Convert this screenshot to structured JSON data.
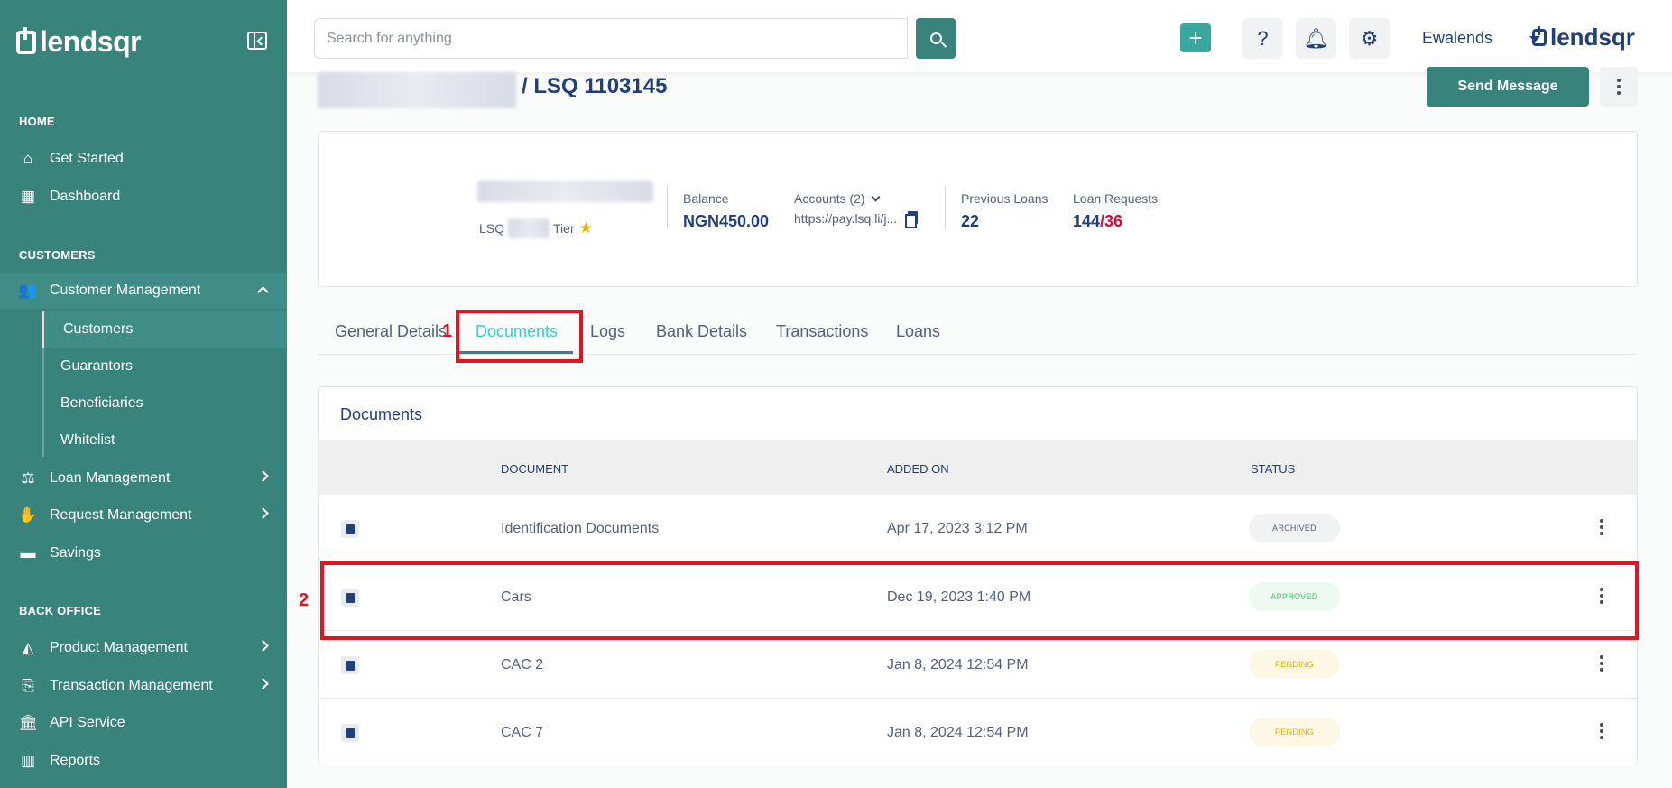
{
  "sidebar": {
    "logo": "lendsqr",
    "sections": {
      "home": "HOME",
      "customers": "CUSTOMERS",
      "back_office": "BACK OFFICE"
    },
    "items": {
      "get_started": "Get Started",
      "dashboard": "Dashboard",
      "customer_management": "Customer Management",
      "customers": "Customers",
      "guarantors": "Guarantors",
      "beneficiaries": "Beneficiaries",
      "whitelist": "Whitelist",
      "loan_management": "Loan Management",
      "request_management": "Request Management",
      "savings": "Savings",
      "product_management": "Product Management",
      "transaction_management": "Transaction Management",
      "api_service": "API Service",
      "reports": "Reports"
    }
  },
  "header": {
    "search_placeholder": "Search for anything",
    "user_name": "Ewalends",
    "brand": "lendsqr"
  },
  "page": {
    "title": "/ LSQ 1103145",
    "send_message": "Send Message"
  },
  "profile": {
    "lsq_label": "LSQ",
    "tier_label": "Tier",
    "balance_label": "Balance",
    "balance_value": "NGN450.00",
    "accounts_label": "Accounts (2)",
    "accounts_url": "https://pay.lsq.li/j...",
    "previous_loans_label": "Previous Loans",
    "previous_loans_value": "22",
    "loan_requests_label": "Loan Requests",
    "loan_requests_value": "144",
    "loan_requests_value_red": "/36"
  },
  "tabs": [
    "General Details",
    "Documents",
    "Logs",
    "Bank Details",
    "Transactions",
    "Loans"
  ],
  "annotations": {
    "one": "1",
    "two": "2"
  },
  "documents": {
    "title": "Documents",
    "columns": {
      "document": "DOCUMENT",
      "added_on": "ADDED ON",
      "status": "STATUS"
    },
    "rows": [
      {
        "name": "Identification Documents",
        "added_on": "Apr 17, 2023 3:12 PM",
        "status": "ARCHIVED"
      },
      {
        "name": "Cars",
        "added_on": "Dec 19, 2023 1:40 PM",
        "status": "APPROVED"
      },
      {
        "name": "CAC 2",
        "added_on": "Jan 8, 2024 12:54 PM",
        "status": "PENDING"
      },
      {
        "name": "CAC 7",
        "added_on": "Jan 8, 2024 12:54 PM",
        "status": "PENDING"
      }
    ]
  },
  "colors": {
    "sidebar": "#39837d",
    "primary_text": "#213f7d",
    "active_tab": "#39cdcc",
    "annotation": "#e5131f"
  }
}
